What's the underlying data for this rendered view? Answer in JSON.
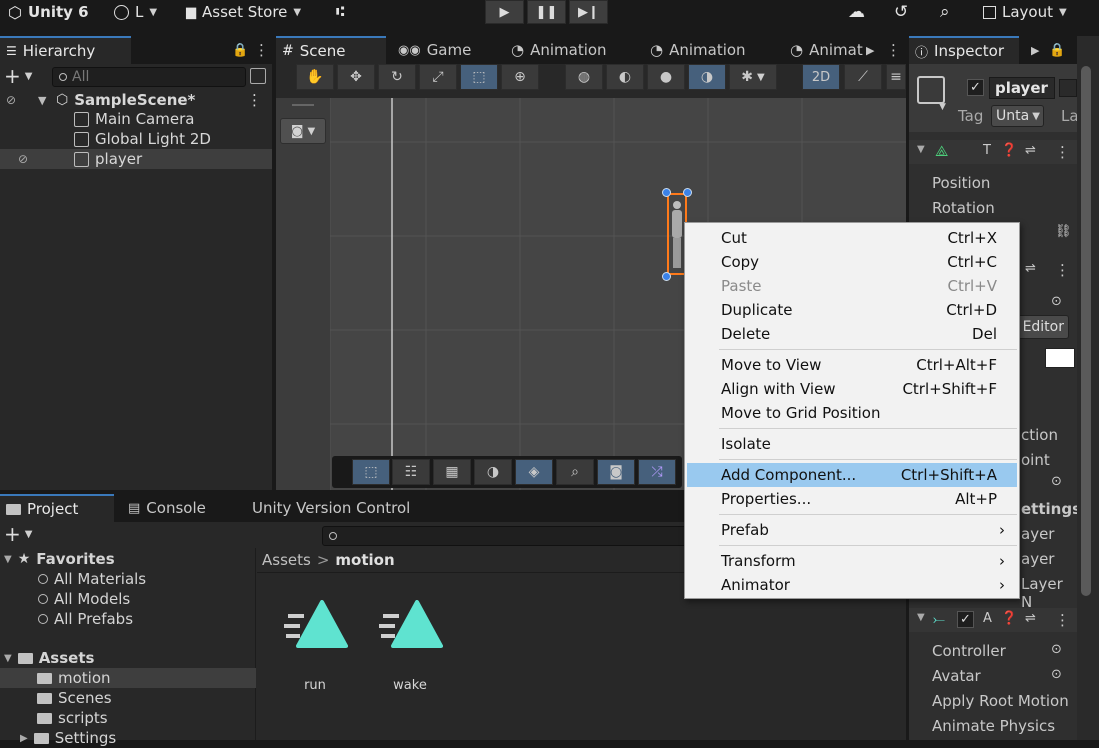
{
  "topbar": {
    "app_title": "Unity 6",
    "account": "L",
    "asset_store": "Asset Store",
    "layout": "Layout"
  },
  "hierarchy": {
    "tab": "Hierarchy",
    "search_placeholder": "All",
    "scene_name": "SampleScene*",
    "items": [
      {
        "label": "Main Camera"
      },
      {
        "label": "Global Light 2D"
      },
      {
        "label": "player"
      }
    ]
  },
  "scene_tabs": [
    {
      "label": "Scene"
    },
    {
      "label": "Game"
    },
    {
      "label": "Animation"
    },
    {
      "label": "Animation"
    },
    {
      "label": "Animat"
    }
  ],
  "scene_toolbar": {
    "mode_2d": "2D"
  },
  "inspector": {
    "tab": "Inspector",
    "object_name": "player",
    "tag_label": "Tag",
    "tag_value": "Unta",
    "layer_label": "La",
    "position": "Position",
    "rotation": "Rotation",
    "editor_button": "Editor",
    "partial_lines": [
      "ction",
      "oint",
      "ettings",
      "ayer",
      "ayer",
      "Layer N"
    ],
    "animator_fields": [
      "Controller",
      "Avatar",
      "Apply Root Motion",
      "Animate Physics"
    ]
  },
  "context_menu": {
    "groups": [
      [
        {
          "label": "Cut",
          "shortcut": "Ctrl+X"
        },
        {
          "label": "Copy",
          "shortcut": "Ctrl+C"
        },
        {
          "label": "Paste",
          "shortcut": "Ctrl+V",
          "disabled": true
        },
        {
          "label": "Duplicate",
          "shortcut": "Ctrl+D"
        },
        {
          "label": "Delete",
          "shortcut": "Del"
        }
      ],
      [
        {
          "label": "Move to View",
          "shortcut": "Ctrl+Alt+F"
        },
        {
          "label": "Align with View",
          "shortcut": "Ctrl+Shift+F"
        },
        {
          "label": "Move to Grid Position",
          "shortcut": ""
        }
      ],
      [
        {
          "label": "Isolate",
          "shortcut": ""
        }
      ],
      [
        {
          "label": "Add Component...",
          "shortcut": "Ctrl+Shift+A",
          "highlighted": true
        },
        {
          "label": "Properties...",
          "shortcut": "Alt+P"
        }
      ],
      [
        {
          "label": "Prefab",
          "shortcut": "›"
        }
      ],
      [
        {
          "label": "Transform",
          "shortcut": "›"
        },
        {
          "label": "Animator",
          "shortcut": "›"
        }
      ]
    ]
  },
  "bottom_tabs": {
    "project": "Project",
    "console": "Console",
    "vcs": "Unity Version Control"
  },
  "project": {
    "favorites_label": "Favorites",
    "favorites": [
      "All Materials",
      "All Models",
      "All Prefabs"
    ],
    "assets_label": "Assets",
    "folders": [
      "motion",
      "Scenes",
      "scripts",
      "Settings"
    ],
    "breadcrumb_root": "Assets",
    "breadcrumb_sep": ">",
    "breadcrumb_current": "motion",
    "files": [
      {
        "name": "run"
      },
      {
        "name": "wake"
      }
    ]
  },
  "colors": {
    "accent_blue": "#3a79bb",
    "menu_highlight": "#99c9ef",
    "anim_clip": "#5fe3d0",
    "selection_orange": "#ff7a1a"
  }
}
